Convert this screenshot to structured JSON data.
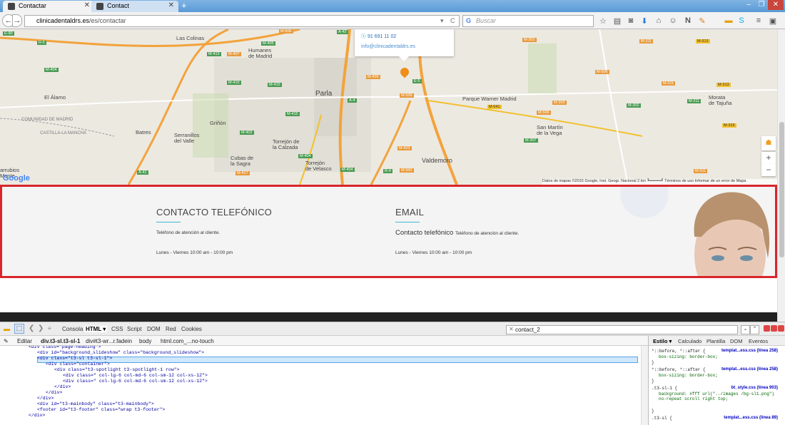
{
  "browser": {
    "tabs": [
      {
        "title": "Contactar"
      },
      {
        "title": "Contact"
      }
    ],
    "new_tab_label": "+",
    "window_controls": [
      "–",
      "❐",
      "✕"
    ],
    "url_host": "clinicadentaldrs.es",
    "url_path": "/es/contactar",
    "search_placeholder": "Buscar",
    "search_engine_glyph": "G",
    "nav": {
      "back": "←",
      "forward": "→",
      "reload": "C",
      "dropdown": "▾"
    },
    "toolbar_icons": [
      "☆",
      "▤",
      "⬇",
      "⌂",
      "☺",
      "N",
      "≡"
    ]
  },
  "map": {
    "infowindow": {
      "phone": "91 691 11 02",
      "email": "info@clinicadentaldrs.es"
    },
    "places": [
      {
        "name": "Las Colinas"
      },
      {
        "name": "Humanes\nde Madrid"
      },
      {
        "name": "El Álamo"
      },
      {
        "name": "Parla"
      },
      {
        "name": "Parque Warner Madrid"
      },
      {
        "name": "Morata\nde Tajuña"
      },
      {
        "name": "COMUNIDAD DE MADRID"
      },
      {
        "name": "CASTILLA-LA MANCHA"
      },
      {
        "name": "Batres"
      },
      {
        "name": "Serranillos\ndel Valle"
      },
      {
        "name": "Griñón"
      },
      {
        "name": "Torrejón de\nla Calzada"
      },
      {
        "name": "San Martín\nde la Vega"
      },
      {
        "name": "Cubas de\nla Sagra"
      },
      {
        "name": "Torrejón\nde Velasco"
      },
      {
        "name": "Valdemoro"
      },
      {
        "name": "arrubios\nMonte"
      }
    ],
    "roads": [
      "E-90",
      "R-5",
      "M-413",
      "M-407",
      "M-405",
      "M-506",
      "A-42",
      "M-404",
      "M-410",
      "M-415",
      "M-409",
      "A-4",
      "E-5",
      "M-506",
      "M-301",
      "M-311",
      "M-313",
      "M-307",
      "M-415",
      "M-402",
      "M-404",
      "M-423",
      "M-417",
      "M-404",
      "R-4",
      "M-942",
      "A-41",
      "M-541",
      "M-506",
      "M-303",
      "M-302",
      "M-311",
      "M-313",
      "M-311",
      "M-315",
      "M-506",
      "M-311"
    ],
    "zoom_in": "+",
    "zoom_out": "−",
    "pegman": "☗",
    "google_logo": "Google",
    "attribution": "Datos de mapas ©2015 Google, Inst. Geogr. Nacional   2 km ┗━━━━━┛   Términos de uso   Informar de un error de Mapa"
  },
  "contact": {
    "col1_title": "CONTACTO TELEFÓNICO",
    "col1_line1": "Teléfono de atención al cliente.",
    "col1_line2": "Lunes - Viernes 10:00 am - 10:00 pm",
    "col2_title": "EMAIL",
    "col2_lead": "Contacto telefónico",
    "col2_line1": "Teléfono de atención al cliente.",
    "col2_line2": "Lunes - Viernes 10:00 am - 10:00 pm"
  },
  "devtools": {
    "tabs": [
      "Consola",
      "HTML ▾",
      "CSS",
      "Script",
      "DOM",
      "Red",
      "Cookies"
    ],
    "edit_label": "Editar",
    "breadcrumbs": [
      "div.t3-sl.t3-sl-1",
      "div#t3-wr...r.fadein",
      "body",
      "html.com_...no-touch"
    ],
    "search_value": "contact_2",
    "html_lines": [
      {
        "indent": 0,
        "text": "<div class=\"page-heading\">"
      },
      {
        "indent": 1,
        "text": "<div id=\"background_slideshow\" class=\"background_slideshow\">"
      },
      {
        "indent": 1,
        "text": "<div class=\"t3-sl t3-sl-1\">"
      },
      {
        "indent": 2,
        "text": "<div class=\"container\">"
      },
      {
        "indent": 3,
        "text": "<div class=\"t3-spotlight t3-spotlight-1 row\">"
      },
      {
        "indent": 4,
        "text": "<div class=\" col-lg-6 col-md-6 col-sm-12 col-xs-12\">"
      },
      {
        "indent": 4,
        "text": "<div class=\" col-lg-6 col-md-6 col-sm-12 col-xs-12\">"
      },
      {
        "indent": 3,
        "text": "</div>"
      },
      {
        "indent": 2,
        "text": "</div>"
      },
      {
        "indent": 1,
        "text": "</div>"
      },
      {
        "indent": 1,
        "text": "<div id=\"t3-mainbody\" class=\"t3-mainbody\">"
      },
      {
        "indent": 1,
        "text": "<footer id=\"t3-footer\" class=\"wrap t3-footer\">"
      },
      {
        "indent": 0,
        "text": "</div>"
      }
    ],
    "side_tabs": [
      "Estilo ▾",
      "Calculado",
      "Plantilla",
      "DOM",
      "Eventos"
    ],
    "css_rules": [
      {
        "selector": "*::before, *::after {",
        "source": "templat...ess.css (línea 258)",
        "decl": "box-sizing: border-box;"
      },
      {
        "selector": "*::before, *::after {",
        "source": "templat...ess.css (línea 258)",
        "decl": "box-sizing: border-box;"
      },
      {
        "selector": ".t3-sl-1 {",
        "source": "bt_style.css (línea 903)",
        "decl": "background: #fff url(\"../images /bg-sl1.png\") no-repeat scroll right top;"
      },
      {
        "selector": ".t3-sl {",
        "source": "templat...ess.css (línea 89)",
        "decl": ""
      }
    ]
  }
}
